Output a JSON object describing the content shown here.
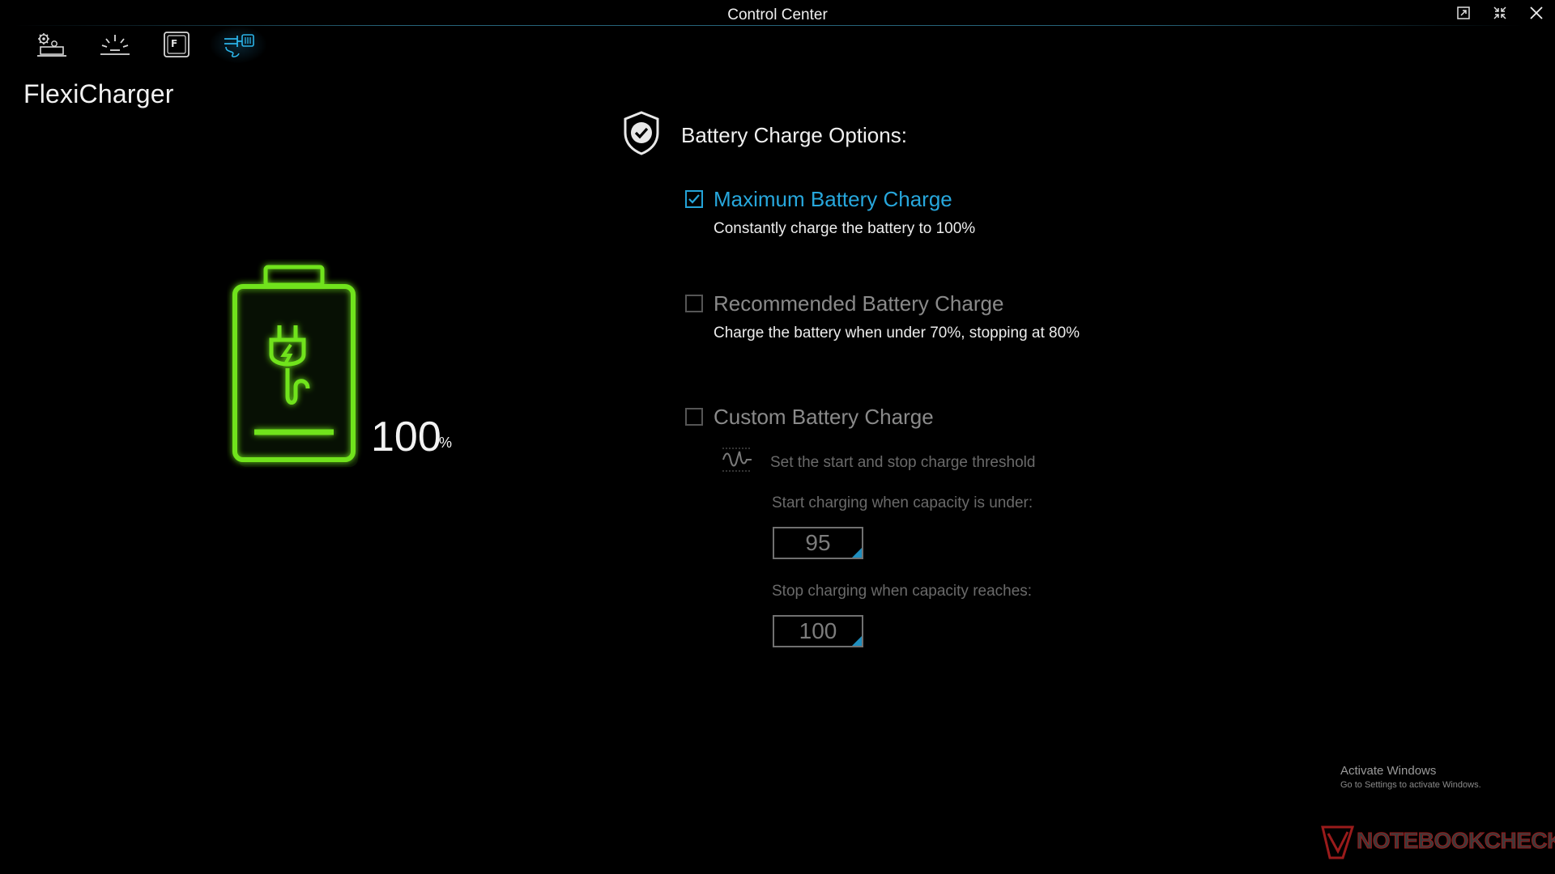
{
  "window": {
    "title": "Control Center"
  },
  "nav": {
    "items": [
      {
        "icon": "system-settings-icon",
        "active": false
      },
      {
        "icon": "brightness-icon",
        "active": false
      },
      {
        "icon": "function-key-icon",
        "active": false
      },
      {
        "icon": "flexicharger-icon",
        "active": true
      }
    ]
  },
  "page": {
    "title": "FlexiCharger"
  },
  "battery": {
    "level": "100",
    "unit": "%",
    "color": "#6fe31a"
  },
  "options": {
    "heading": "Battery Charge Options:",
    "maximum": {
      "label": "Maximum Battery Charge",
      "description": "Constantly charge the battery to 100%",
      "checked": true
    },
    "recommended": {
      "label": "Recommended Battery Charge",
      "description": "Charge the battery when under 70%, stopping at 80%",
      "checked": false
    },
    "custom": {
      "label": "Custom Battery Charge",
      "checked": false,
      "threshold_hint": "Set the start and stop charge threshold",
      "start_label": "Start charging when capacity is under:",
      "start_value": "95",
      "stop_label": "Stop charging when capacity reaches:",
      "stop_value": "100"
    }
  },
  "activation": {
    "title": "Activate Windows",
    "subtitle": "Go to Settings to activate Windows."
  },
  "watermark": {
    "text": "NOTEBOOKCHECK"
  },
  "colors": {
    "accent": "#27a7dc",
    "battery_green": "#6fe31a",
    "background": "#000000"
  }
}
